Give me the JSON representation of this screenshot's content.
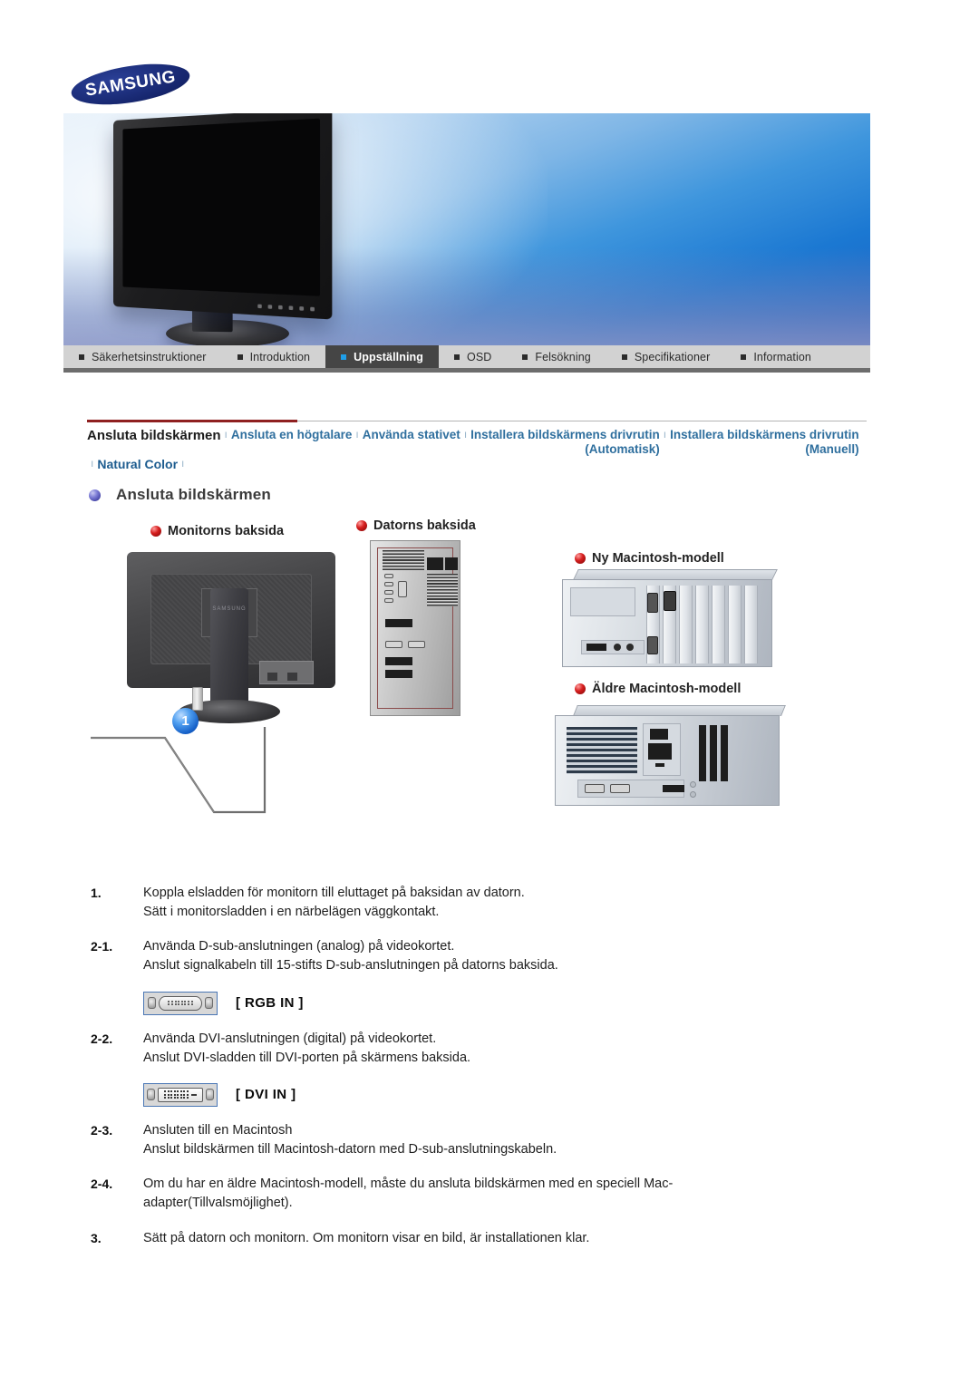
{
  "brand": {
    "logo_text": "SAMSUNG"
  },
  "hero": {
    "alt": "samsung-monitor-hero-image"
  },
  "nav": {
    "items": [
      {
        "label": "Säkerhetsinstruktioner",
        "active": false
      },
      {
        "label": "Introduktion",
        "active": false
      },
      {
        "label": "Uppställning",
        "active": true
      },
      {
        "label": "OSD",
        "active": false
      },
      {
        "label": "Felsökning",
        "active": false
      },
      {
        "label": "Specifikationer",
        "active": false
      },
      {
        "label": "Information",
        "active": false
      }
    ]
  },
  "subnav": {
    "items": [
      {
        "label": "Ansluta bildskärmen",
        "sub": "",
        "style": "first"
      },
      {
        "label": "Ansluta en högtalare",
        "sub": "",
        "style": "link"
      },
      {
        "label": "Använda stativet",
        "sub": "",
        "style": "link"
      },
      {
        "label": "Installera bildskärmens drivrutin",
        "sub": "(Automatisk)",
        "style": "link"
      },
      {
        "label": "Installera bildskärmens drivrutin",
        "sub": "(Manuell)",
        "style": "link"
      },
      {
        "label": "Natural Color",
        "sub": "",
        "style": "strong"
      }
    ],
    "separator": "ı"
  },
  "section": {
    "title": "Ansluta bildskärmen"
  },
  "diagram": {
    "labels": {
      "monitor_back": "Monitorns baksida",
      "computer_back": "Datorns baksida",
      "new_mac": "Ny Macintosh-modell",
      "old_mac": "Äldre Macintosh-modell"
    },
    "badges": {
      "one": "1"
    },
    "stand_logo": "SAMSUNG"
  },
  "instructions": {
    "steps": [
      {
        "num": "1.",
        "lines": [
          "Koppla elsladden för monitorn till eluttaget på baksidan av datorn.",
          "Sätt i monitorsladden i en närbelägen väggkontakt."
        ]
      },
      {
        "num": "2-1.",
        "lines": [
          "Använda D-sub-anslutningen (analog) på videokortet.",
          "Anslut signalkabeln till 15-stifts D-sub-anslutningen på datorns baksida."
        ]
      },
      {
        "num": "2-2.",
        "lines": [
          "Använda DVI-anslutningen (digital) på videokortet.",
          "Anslut DVI-sladden till DVI-porten på skärmens baksida."
        ]
      },
      {
        "num": "2-3.",
        "lines": [
          "Ansluten till en Macintosh",
          "Anslut bildskärmen till Macintosh-datorn med D-sub-anslutningskabeln."
        ]
      },
      {
        "num": "2-4.",
        "lines": [
          "Om du har en äldre Macintosh-modell, måste du ansluta bildskärmen med en speciell Mac-",
          "adapter(Tillvalsmöjlighet)."
        ]
      },
      {
        "num": "3.",
        "lines": [
          "Sätt på datorn och monitorn. Om monitorn visar en bild, är installationen klar."
        ]
      }
    ],
    "connectors": {
      "rgb": "[ RGB IN ]",
      "dvi": "[ DVI IN ]"
    }
  },
  "colors": {
    "brand_blue": "#16266e",
    "accent_blue": "#1f9ee8",
    "nav_bg": "#d2d2d2",
    "nav_active_bg": "#454545",
    "link_blue": "#2f6f9e",
    "rule_red": "#8f2020"
  }
}
